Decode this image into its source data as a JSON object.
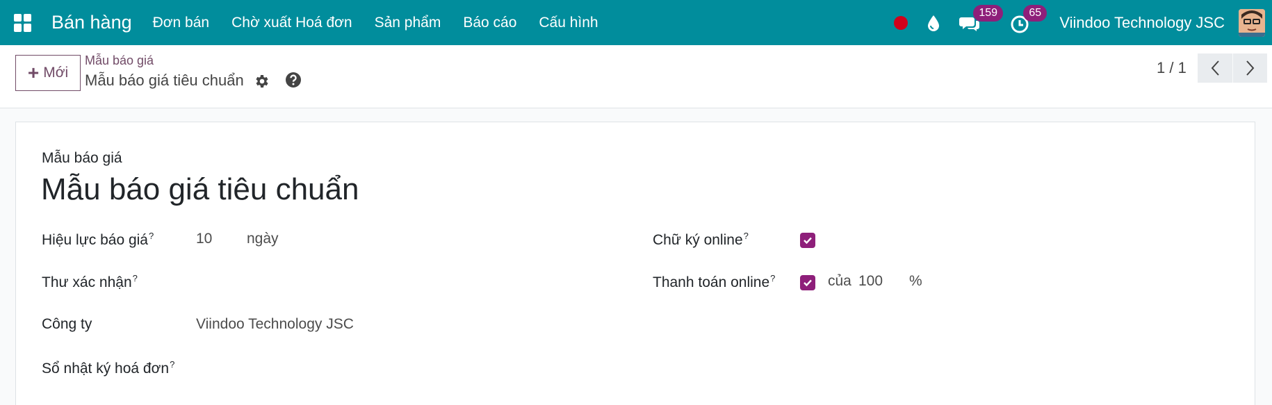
{
  "navbar": {
    "app_name": "Bán hàng",
    "menu": [
      "Đơn bán",
      "Chờ xuất Hoá đơn",
      "Sản phẩm",
      "Báo cáo",
      "Cấu hình"
    ],
    "messages_count": "159",
    "activities_count": "65",
    "company": "Viindoo Technology JSC"
  },
  "control": {
    "new_label": "Mới",
    "breadcrumb_parent": "Mẫu báo giá",
    "breadcrumb_current": "Mẫu báo giá tiêu chuẩn",
    "pager_value": "1 / 1"
  },
  "form": {
    "label_top": "Mẫu báo giá",
    "title": "Mẫu báo giá tiêu chuẩn",
    "validity_label": "Hiệu lực báo giá",
    "validity_value": "10",
    "validity_unit": "ngày",
    "confirmation_mail_label": "Thư xác nhận",
    "company_label": "Công ty",
    "company_value": "Viindoo Technology JSC",
    "journal_label": "Sổ nhật ký hoá đơn",
    "online_signature_label": "Chữ ký online",
    "online_payment_label": "Thanh toán online",
    "payment_prefix": "của",
    "payment_value": "100",
    "payment_unit": "%",
    "help_mark": "?"
  },
  "colors": {
    "navbar": "#018d9c",
    "accent": "#714b67",
    "badge": "#8e1f7a",
    "checkbox": "#8e1f7a"
  }
}
